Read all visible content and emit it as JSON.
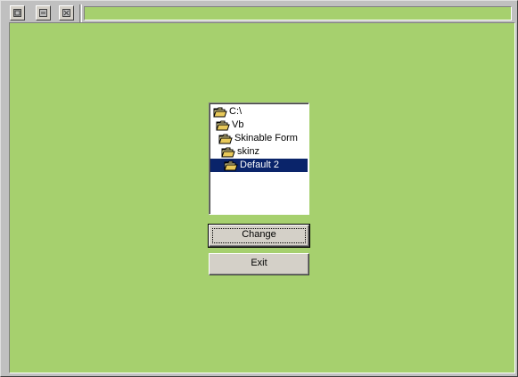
{
  "window": {
    "title_text": "",
    "accent_color": "#a6d06e",
    "title_buttons": [
      {
        "name": "minimize",
        "icon": "minimize-icon"
      },
      {
        "name": "maximize",
        "icon": "maximize-icon"
      },
      {
        "name": "close",
        "icon": "close-icon"
      }
    ]
  },
  "dir_list": {
    "items": [
      {
        "label": "C:\\",
        "icon": "folder-open-icon",
        "selected": false
      },
      {
        "label": "Vb",
        "icon": "folder-open-icon",
        "selected": false
      },
      {
        "label": "Skinable Form",
        "icon": "folder-open-icon",
        "selected": false
      },
      {
        "label": "skinz",
        "icon": "folder-open-icon",
        "selected": false
      },
      {
        "label": "Default 2",
        "icon": "folder-open-icon",
        "selected": true
      }
    ]
  },
  "buttons": {
    "change_label": "Change",
    "exit_label": "Exit"
  },
  "colors": {
    "selection": "#0a246a",
    "client_background": "#a6d06e"
  }
}
